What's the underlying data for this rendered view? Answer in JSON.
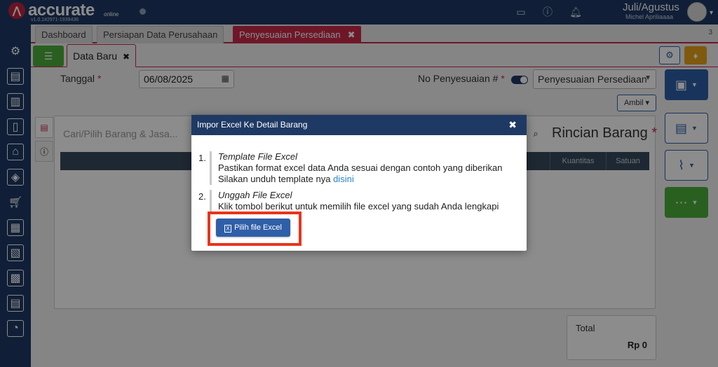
{
  "header": {
    "brand": "accurate",
    "brand_sub": "online",
    "version": "v1.0.1#2971-1939436",
    "period": "Juli/Agustus",
    "user": "Michel Apriliaaaa"
  },
  "tabs": [
    {
      "label": "Dashboard"
    },
    {
      "label": "Persiapan Data Perusahaan"
    },
    {
      "label": "Penyesuaian Persediaan",
      "close": "✖"
    }
  ],
  "tab_count": "3",
  "subtab": {
    "label": "Data Baru",
    "close": "✖"
  },
  "form": {
    "tanggal_label": "Tanggal",
    "required_mark": "*",
    "tanggal_value": "06/08/2025",
    "no_label": "No Penyesuaian #",
    "no_select": "Penyesuaian Persediaan",
    "ambil_label": "Ambil"
  },
  "detail": {
    "search_placeholder": "Cari/Pilih Barang & Jasa...",
    "title": "Rincian Barang",
    "columns": [
      "Kuantitas",
      "Satuan"
    ]
  },
  "total": {
    "label": "Total",
    "value": "Rp 0"
  },
  "modal": {
    "title": "Impor Excel Ke Detail Barang",
    "close": "✖",
    "step1": {
      "num": "1.",
      "title": "Template File Excel",
      "line1": "Pastikan format excel data Anda sesuai dengan contoh yang diberikan",
      "line2": "Silakan unduh template nya",
      "link": "disini"
    },
    "step2": {
      "num": "2.",
      "title": "Unggah File Excel",
      "line1": "Klik tombol berikut untuk memilih file excel yang sudah Anda lengkapi"
    },
    "button": "Pilih file Excel"
  },
  "colors": {
    "navy": "#1e3a64",
    "crimson": "#c92b4c",
    "highlight": "#e8341c"
  }
}
